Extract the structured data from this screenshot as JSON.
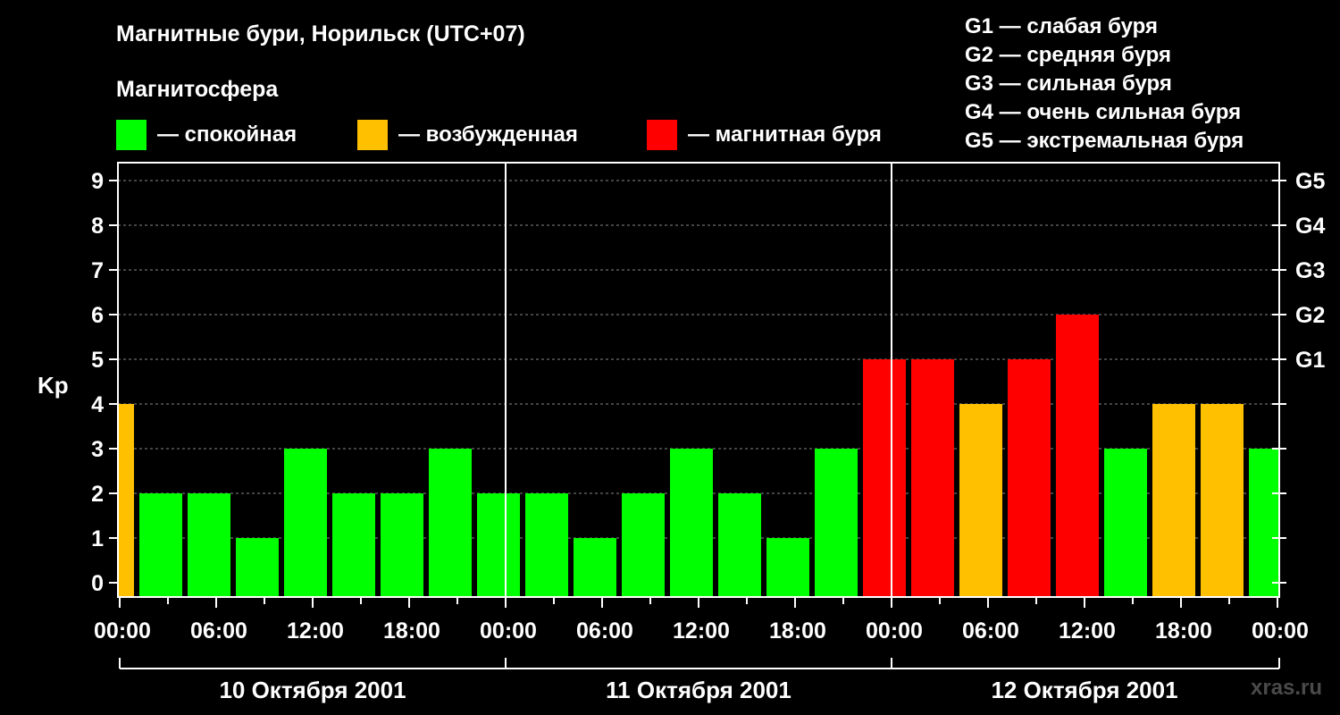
{
  "title": "Магнитные бури, Норильск (UTC+07)",
  "subtitle": "Магнитосфера",
  "legend": [
    {
      "label": "— спокойная",
      "color": "#00ff00"
    },
    {
      "label": "— возбужденная",
      "color": "#ffc000"
    },
    {
      "label": "— магнитная буря",
      "color": "#ff0000"
    }
  ],
  "g_scale": [
    "G1 — слабая буря",
    "G2 — средняя буря",
    "G3 — сильная буря",
    "G4 — очень сильная буря",
    "G5 — экстремальная буря"
  ],
  "watermark": "xras.ru",
  "chart_data": {
    "type": "bar",
    "ylabel": "Kp",
    "ylim": [
      0,
      9
    ],
    "yticks": [
      "0",
      "1",
      "2",
      "3",
      "4",
      "5",
      "6",
      "7",
      "8",
      "9"
    ],
    "right_ticks": [
      {
        "value": 5,
        "label": "G1"
      },
      {
        "value": 6,
        "label": "G2"
      },
      {
        "value": 7,
        "label": "G3"
      },
      {
        "value": 8,
        "label": "G4"
      },
      {
        "value": 9,
        "label": "G5"
      }
    ],
    "xticks": [
      "00:00",
      "06:00",
      "12:00",
      "18:00",
      "00:00",
      "06:00",
      "12:00",
      "18:00",
      "00:00",
      "06:00",
      "12:00",
      "18:00",
      "00:00"
    ],
    "days": [
      "10 Октября 2001",
      "11 Октября 2001",
      "12 Октября 2001"
    ],
    "grid": true,
    "colors": {
      "quiet": "#00ff00",
      "active": "#ffc000",
      "storm": "#ff0000"
    },
    "series": [
      {
        "values": [
          4,
          2,
          2,
          1,
          3,
          2,
          2,
          3,
          2,
          2,
          1,
          2,
          3,
          2,
          1,
          3,
          5,
          5,
          4,
          5,
          6,
          3,
          4,
          4,
          3
        ]
      }
    ]
  }
}
